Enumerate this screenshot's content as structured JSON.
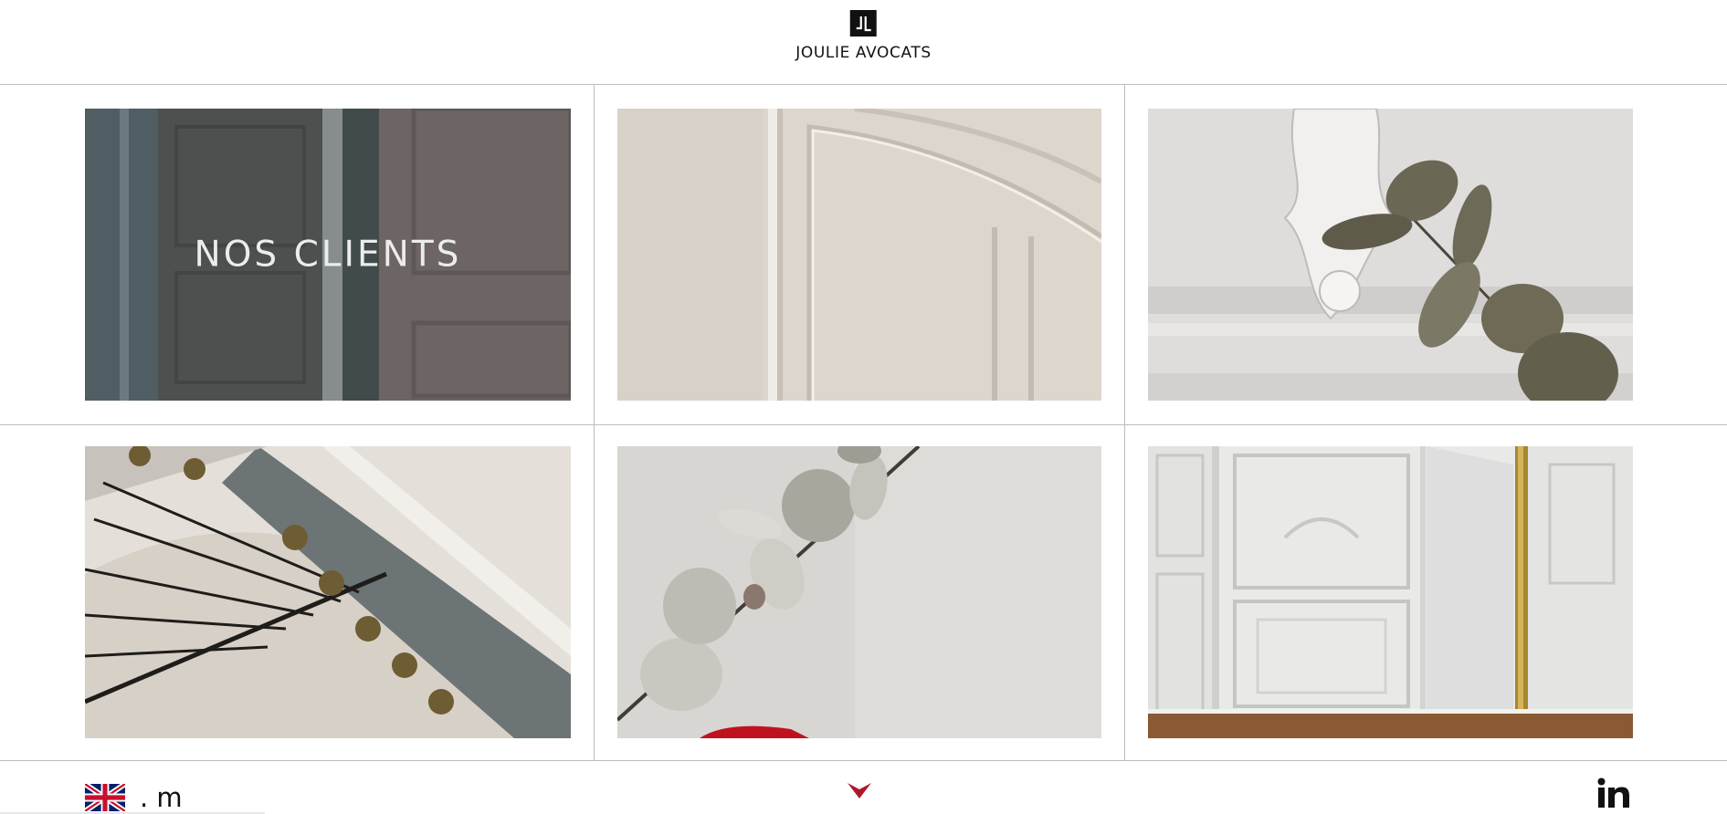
{
  "header": {
    "logo_text": "JOULIE AVOCATS",
    "logo_mark": "JL",
    "brand_color": "#111111"
  },
  "tiles": [
    {
      "label": "NOS CLIENTS",
      "photo": "grey paneled door"
    },
    {
      "label": "",
      "photo": "curved cream wall moulding"
    },
    {
      "label": "",
      "photo": "plaster ornament with dried eucalyptus"
    },
    {
      "label": "",
      "photo": "staircase with wrought iron balusters"
    },
    {
      "label": "",
      "photo": "dried eucalyptus branch"
    },
    {
      "label": "",
      "photo": "white paneled room with gilded mirror"
    }
  ],
  "footer": {
    "language_text": ". m",
    "language_icon": "uk-flag-icon",
    "scroll_icon": "chevron-down-icon",
    "scroll_color": "#b0162c",
    "social_icon": "linkedin-icon"
  }
}
